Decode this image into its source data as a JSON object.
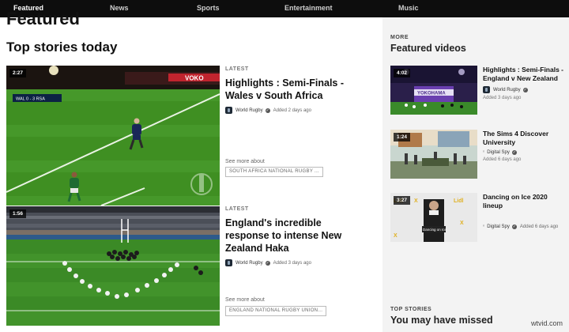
{
  "nav": {
    "items": [
      {
        "label": "Featured"
      },
      {
        "label": "News"
      },
      {
        "label": "Sports"
      },
      {
        "label": "Entertainment"
      },
      {
        "label": "Music"
      }
    ]
  },
  "main": {
    "featured_heading": "Featured",
    "section_title": "Top stories today",
    "stories": [
      {
        "duration": "2:27",
        "label": "LATEST",
        "headline": "Highlights : Semi-Finals - Wales v South Africa",
        "source": "World Rugby",
        "date": "Added 2 days ago",
        "see_more": "See more about",
        "tag": "SOUTH AFRICA NATIONAL RUGBY ...",
        "scoreboard": "WAL 0 - 3 RSA",
        "banner_text": "VOKO"
      },
      {
        "duration": "1:56",
        "label": "LATEST",
        "headline": "England's incredible response to intense New Zealand Haka",
        "source": "World Rugby",
        "date": "Added 3 days ago",
        "see_more": "See more about",
        "tag": "ENGLAND NATIONAL RUGBY UNION..."
      }
    ]
  },
  "sidebar": {
    "more_label": "MORE",
    "featured_videos": "Featured videos",
    "videos": [
      {
        "duration": "4:02",
        "title": "Highlights : Semi-Finals - England v New Zealand",
        "source": "World Rugby",
        "date": "Added 3 days ago",
        "thumb_text": "YOKOHAMA"
      },
      {
        "duration": "1:24",
        "title": "The Sims 4 Discover University",
        "source": "Digital Spy",
        "date": "Added 6 days ago"
      },
      {
        "duration": "3:27",
        "title": "Dancing on Ice 2020 lineup",
        "source": "Digital Spy",
        "date": "Added 6 days ago",
        "thumb_text": "Dancing on Ice"
      }
    ],
    "top_stories_label": "TOP STORIES",
    "missed_title": "You may have missed"
  },
  "watermark": "wtvid.com"
}
